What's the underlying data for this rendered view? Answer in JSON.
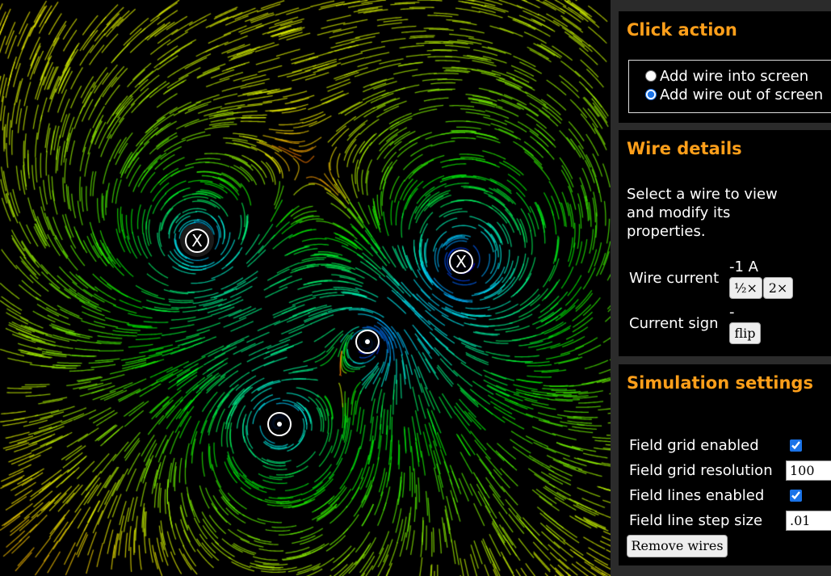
{
  "click_action": {
    "title": "Click action",
    "options": [
      {
        "label": "Add wire into screen",
        "checked": false
      },
      {
        "label": "Add wire out of screen",
        "checked": true
      }
    ]
  },
  "wire_details": {
    "title": "Wire details",
    "description": "Select a wire to view and modify its properties.",
    "current_label": "Wire current",
    "current_value": "-1 A",
    "half_button": "½×",
    "double_button": "2×",
    "sign_label": "Current sign",
    "sign_value": "-",
    "flip_button": "flip"
  },
  "simulation": {
    "title": "Simulation settings",
    "grid_enabled_label": "Field grid enabled",
    "grid_enabled": true,
    "grid_resolution_label": "Field grid resolution",
    "grid_resolution": "100",
    "lines_enabled_label": "Field lines enabled",
    "lines_enabled": true,
    "step_size_label": "Field line step size",
    "step_size": ".01",
    "remove_button": "Remove wires"
  },
  "wires": [
    {
      "direction": "into",
      "current": 1
    },
    {
      "direction": "into",
      "current": 1
    },
    {
      "direction": "out",
      "current": 1
    },
    {
      "direction": "out",
      "current": 1
    }
  ],
  "colors": {
    "accent": "#ff9f1a",
    "panel": "#000000",
    "sidebar": "#2b2b2b"
  }
}
